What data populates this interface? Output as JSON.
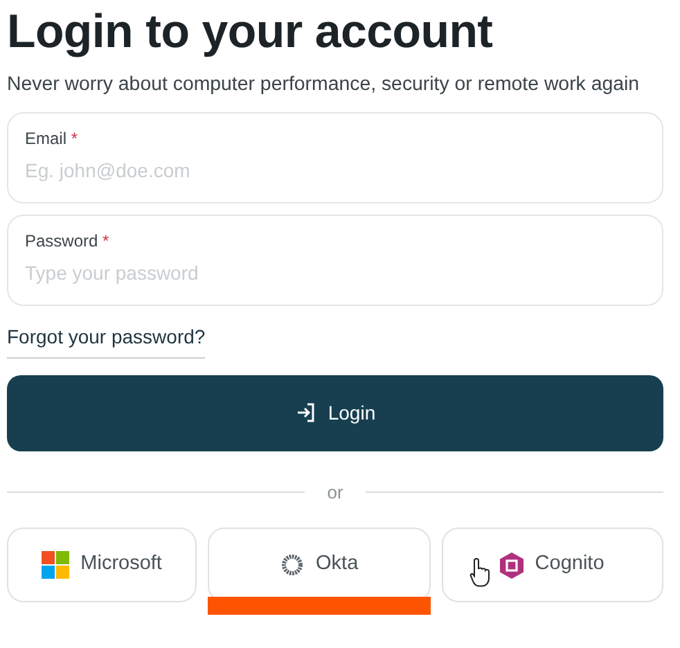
{
  "title": "Login to your account",
  "subtitle": "Never worry about computer performance, security or remote work again",
  "fields": [
    {
      "label": "Email",
      "required_mark": "*",
      "placeholder": "Eg. john@doe.com"
    },
    {
      "label": "Password",
      "required_mark": "*",
      "placeholder": "Type your password"
    }
  ],
  "forgot_link": "Forgot your password?",
  "login_button": "Login",
  "divider": "or",
  "providers": [
    {
      "label": "Microsoft",
      "kind": "microsoft",
      "highlighted": false,
      "hovered": false
    },
    {
      "label": "Okta",
      "kind": "okta",
      "highlighted": true,
      "hovered": false
    },
    {
      "label": "Cognito",
      "kind": "cognito",
      "highlighted": false,
      "hovered": true
    }
  ]
}
